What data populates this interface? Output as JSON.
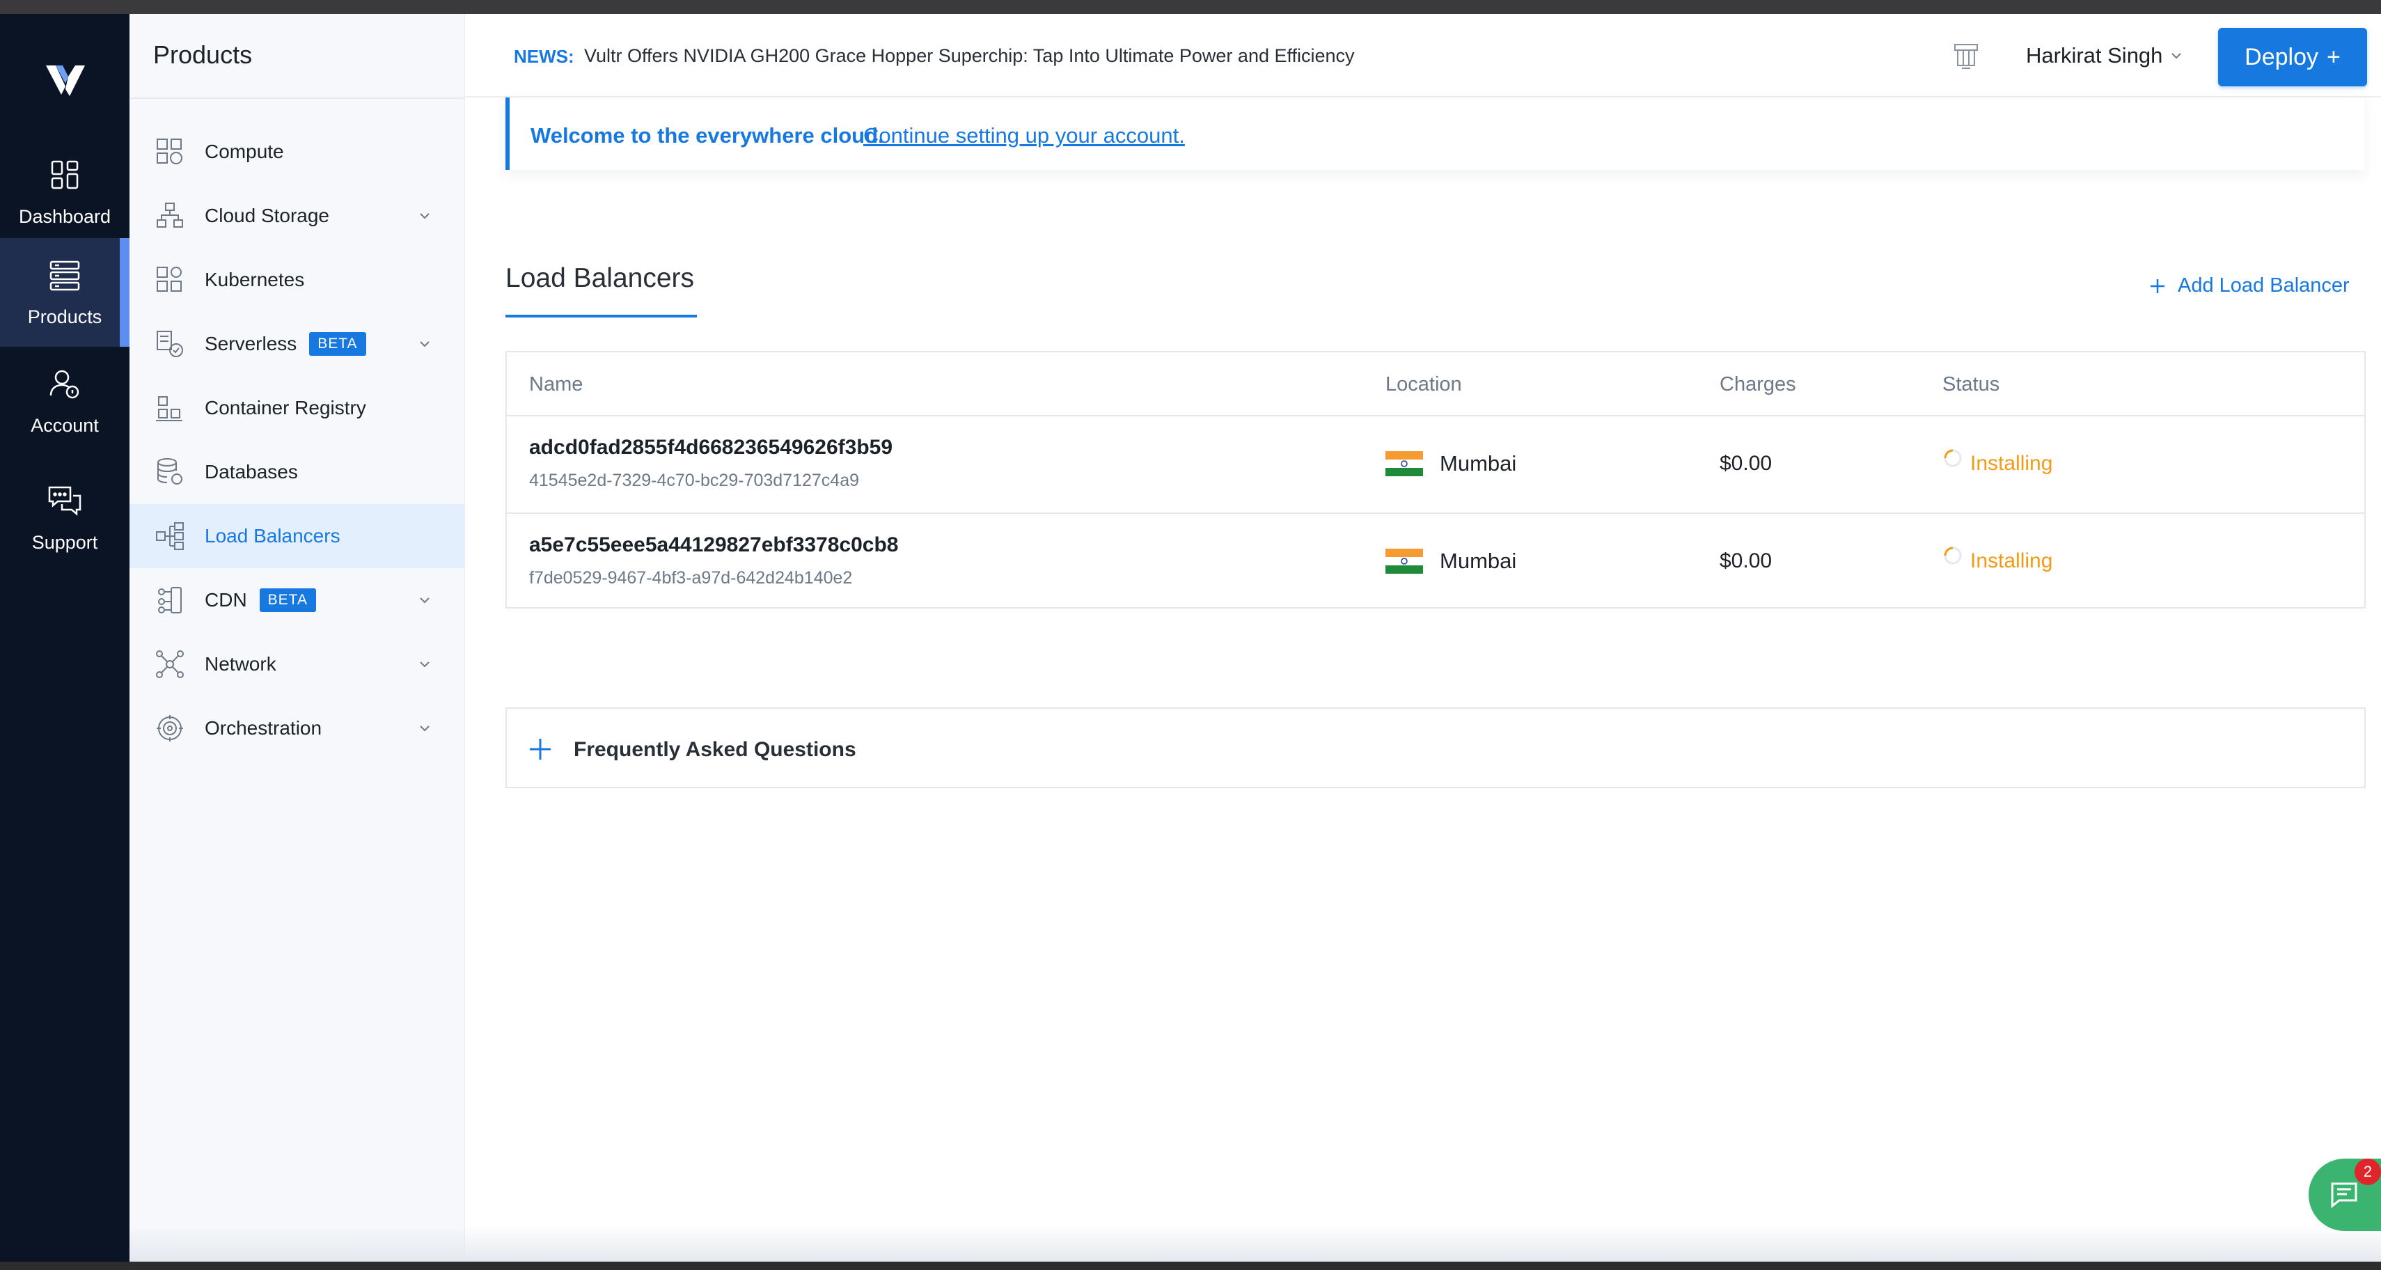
{
  "colors": {
    "accent": "#1779e0",
    "rail_bg": "#0b1425",
    "rail_active": "#1f2e4e",
    "status_installing": "#f39a17",
    "chat": "#3bb46f",
    "notif": "#e0242b"
  },
  "rail": {
    "logo_icon": "vultr-logo-icon",
    "items": [
      {
        "label": "Dashboard",
        "icon": "dashboard-icon"
      },
      {
        "label": "Products",
        "icon": "server-stack-icon"
      },
      {
        "label": "Account",
        "icon": "user-lock-icon"
      },
      {
        "label": "Support",
        "icon": "chat-bubbles-icon"
      }
    ]
  },
  "sidebar": {
    "title": "Products",
    "items": [
      {
        "label": "Compute",
        "icon": "compute-icon"
      },
      {
        "label": "Cloud Storage",
        "icon": "cloud-storage-icon"
      },
      {
        "label": "Kubernetes",
        "icon": "kubernetes-icon"
      },
      {
        "label": "Serverless",
        "icon": "serverless-icon",
        "badge": "BETA"
      },
      {
        "label": "Container Registry",
        "icon": "container-registry-icon"
      },
      {
        "label": "Databases",
        "icon": "database-icon"
      },
      {
        "label": "Load Balancers",
        "icon": "load-balancer-icon"
      },
      {
        "label": "CDN",
        "icon": "cdn-icon",
        "badge": "BETA"
      },
      {
        "label": "Network",
        "icon": "network-icon"
      },
      {
        "label": "Orchestration",
        "icon": "orchestration-icon"
      }
    ]
  },
  "header": {
    "news_label": "NEWS:",
    "news_text": "Vultr Offers NVIDIA GH200 Grace Hopper Superchip: Tap Into Ultimate Power and Efficiency",
    "user_name": "Harkirat Singh",
    "deploy_label": "Deploy",
    "deploy_icon": "+"
  },
  "welcome": {
    "strong": "Welcome to the everywhere cloud.",
    "link": "Continue setting up your account."
  },
  "section": {
    "title": "Load Balancers",
    "add_label": "Add Load Balancer"
  },
  "table": {
    "columns": [
      "Name",
      "Location",
      "Charges",
      "Status"
    ],
    "rows": [
      {
        "name": "adcd0fad2855f4d668236549626f3b59",
        "id": "41545e2d-7329-4c70-bc29-703d7127c4a9",
        "location": "Mumbai",
        "charges": "$0.00",
        "status": "Installing"
      },
      {
        "name": "a5e7c55eee5a44129827ebf3378c0cb8",
        "id": "f7de0529-9467-4bf3-a97d-642d24b140e2",
        "location": "Mumbai",
        "charges": "$0.00",
        "status": "Installing"
      }
    ]
  },
  "faq": {
    "label": "Frequently Asked Questions"
  },
  "chat": {
    "count": "2"
  }
}
